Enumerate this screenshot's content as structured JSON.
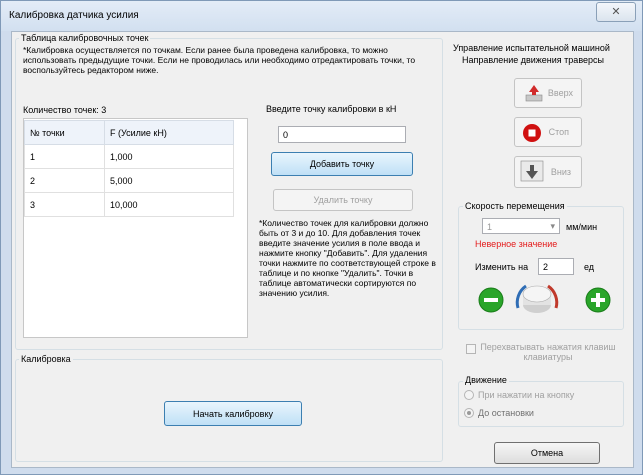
{
  "window": {
    "title": "Калибровка датчика усилия",
    "close_glyph": "✕"
  },
  "calib_table": {
    "group_title": "Таблица калибровочных точек",
    "note": "*Калибровка осуществляется по точкам. Если ранее была проведена калибровка, то можно использовать предыдущие точки. Если не проводилась или необходимо отредактировать точки, то воспользуйтесь редактором ниже.",
    "count_label": "Количество точек: 3",
    "columns": [
      "№ точки",
      "F (Усилие кН)"
    ],
    "rows": [
      [
        "1",
        "1,000"
      ],
      [
        "2",
        "5,000"
      ],
      [
        "3",
        "10,000"
      ]
    ],
    "point_prompt": "Введите точку калибровки в кН",
    "point_value": "0",
    "add_button": "Добавить точку",
    "delete_button": "Удалить точку",
    "help_text": "*Количество точек для калибровки должно быть от 3 и до 10. Для добавления точек введите значение усилия в поле ввода и нажмите кнопку \"Добавить\". Для удаления точки нажмите по соответствующей строке в таблице и по  кнопке \"Удалить\". Точки в таблице автоматически сортируются по значению усилия."
  },
  "calibration": {
    "group_title": "Калибровка",
    "start_button": "Начать калибровку"
  },
  "machine": {
    "title": "Управление испытательной машиной",
    "direction_label": "Направление движения траверсы",
    "up_button": "Вверх",
    "stop_button": "Стоп",
    "down_button": "Вниз",
    "speed_group": "Скорость перемещения",
    "speed_value": "1",
    "speed_unit": "мм/мин",
    "error_text": "Неверное значение",
    "change_label": "Изменить на",
    "change_value": "2",
    "change_unit": "ед",
    "intercept_label": "Перехватывать нажатия клавиш клавиатуры",
    "movement_group": "Движение",
    "radio_press": "При нажатии на кнопку",
    "radio_stop": "До остановки"
  },
  "footer": {
    "cancel_button": "Отмена"
  },
  "colors": {
    "error": "#e41b1b",
    "accent_green": "#2aa52a",
    "stop_red": "#d01010"
  }
}
